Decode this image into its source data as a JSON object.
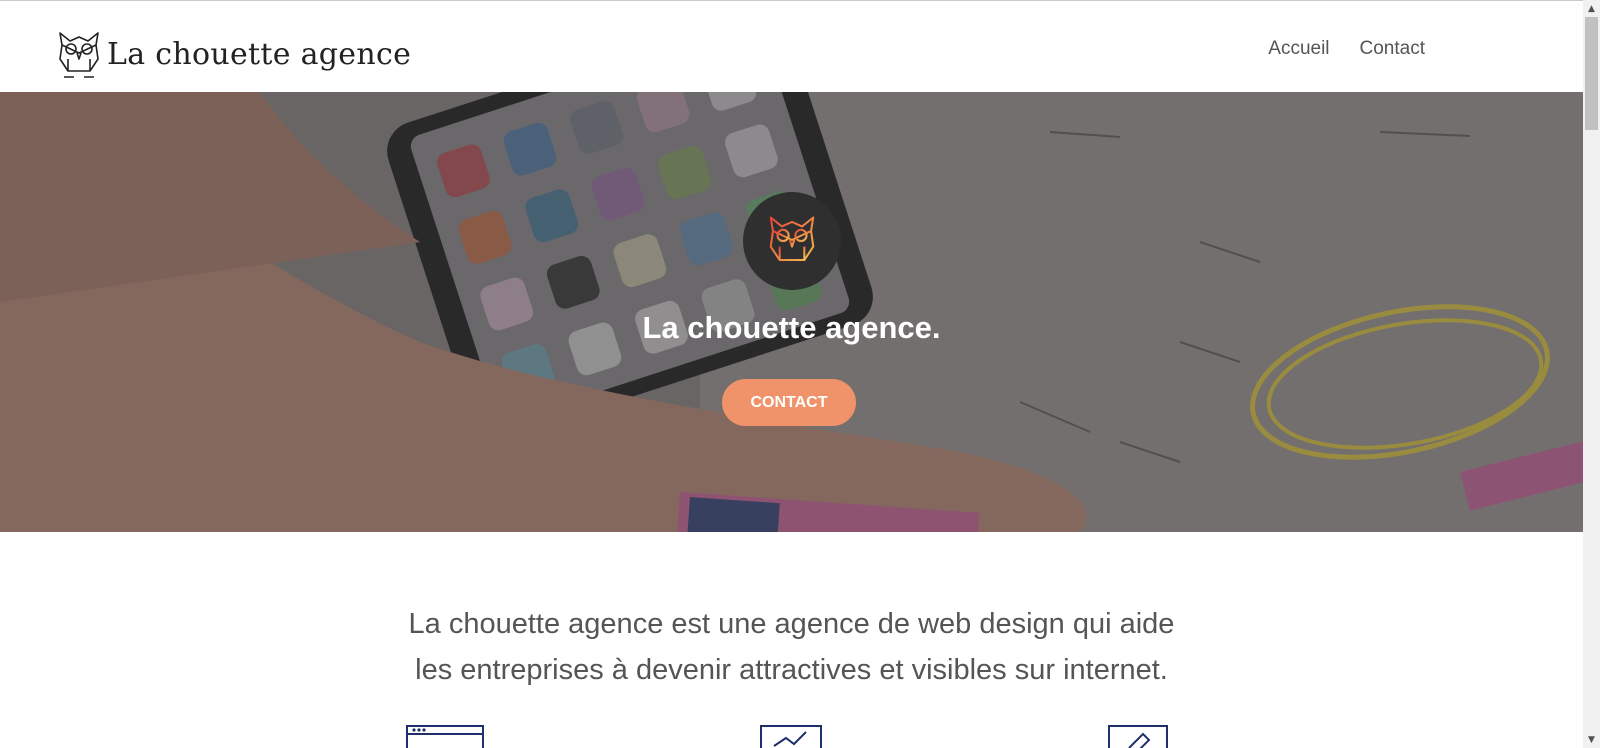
{
  "header": {
    "brand": "La chouette agence",
    "nav": [
      {
        "label": "Accueil"
      },
      {
        "label": "Contact"
      }
    ]
  },
  "hero": {
    "title": "La chouette agence.",
    "cta_label": "CONTACT"
  },
  "intro": {
    "line1": "La chouette agence est une agence de web design qui aide",
    "line2": "les entreprises à devenir attractives et visibles sur internet."
  },
  "icons": {
    "brand": "owl-logo-icon",
    "services": [
      "browser-window-icon",
      "chart-growth-icon",
      "design-pencil-icon"
    ]
  },
  "colors": {
    "accent": "#f0936a",
    "icon_blue": "#1f2f6b"
  }
}
